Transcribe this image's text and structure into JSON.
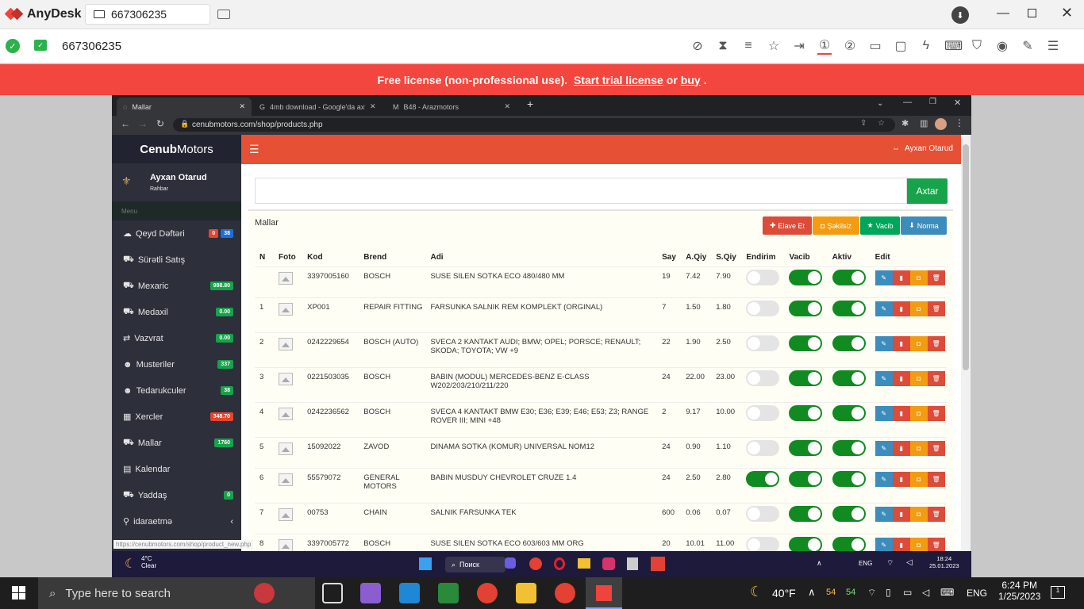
{
  "anydesk": {
    "app_name": "AnyDesk",
    "tab_id": "667306235",
    "address": "667306235",
    "license_text": "Free license (non-professional use).",
    "trial_link": "Start trial license",
    "or": "or",
    "buy_link": "buy",
    "end": "."
  },
  "browser": {
    "tabs": [
      {
        "title": "Mallar"
      },
      {
        "title": "4mb download - Google'da axtar"
      },
      {
        "title": "B48 - Arazmotors"
      }
    ],
    "url": "cenubmotors.com/shop/products.php",
    "status_url": "https://cenubmotors.com/shop/product_new.php"
  },
  "app": {
    "brand_bold": "Cenub",
    "brand_rest": " Motors",
    "user_name": "Ayxan Otarud",
    "user_role": "Rahbar",
    "menu_header": "Menu",
    "top_user": "Ayxan Otarud",
    "sidebar": [
      {
        "label": "Qeyd Dəftəri",
        "badge": "0",
        "badge_color": "#e5442e",
        "badge2": "38",
        "badge2_color": "#1d6fd8"
      },
      {
        "label": "Sürətli Satış"
      },
      {
        "label": "Mexaric",
        "badge": "988.80",
        "badge_color": "#16a34a"
      },
      {
        "label": "Medaxil",
        "badge": "0.00",
        "badge_color": "#16a34a"
      },
      {
        "label": "Vazvrat",
        "badge": "0.00",
        "badge_color": "#16a34a"
      },
      {
        "label": "Musteriler",
        "badge": "337",
        "badge_color": "#16a34a"
      },
      {
        "label": "Tedarukculer",
        "badge": "38",
        "badge_color": "#16a34a"
      },
      {
        "label": "Xercler",
        "badge": "348.70",
        "badge_color": "#e5442e"
      },
      {
        "label": "Mallar",
        "badge": "1760",
        "badge_color": "#16a34a"
      },
      {
        "label": "Kalendar"
      },
      {
        "label": "Yaddaş",
        "badge": "0",
        "badge_color": "#16a34a"
      },
      {
        "label": "idaraetmə",
        "chevron": "‹"
      }
    ],
    "search_button": "Axtar",
    "panel_title": "Mallar",
    "buttons": [
      {
        "label": "Elave Et",
        "color": "#dd4b39"
      },
      {
        "label": "Şəkilsiz",
        "color": "#f39c12"
      },
      {
        "label": "Vacib",
        "color": "#00a65a"
      },
      {
        "label": "Norma",
        "color": "#3c8dbc"
      }
    ],
    "columns": [
      "N",
      "Foto",
      "Kod",
      "Brend",
      "Adi",
      "Say",
      "A.Qiy",
      "S.Qiy",
      "Endirim",
      "Vacib",
      "Aktiv",
      "Edit"
    ],
    "rows": [
      {
        "n": "",
        "kod": "3397005160",
        "brend": "BOSCH",
        "adi": "SUSE SILEN SOTKA ECO 480/480 MM",
        "say": "19",
        "aqiy": "7.42",
        "sqiy": "7.90",
        "endirim": false,
        "vacib": true,
        "aktiv": true
      },
      {
        "n": "1",
        "kod": "XP001",
        "brend": "REPAIR FITTING",
        "adi": "FARSUNKA SALNIK REM KOMPLEKT (ORGINAL)",
        "say": "7",
        "aqiy": "1.50",
        "sqiy": "1.80",
        "endirim": false,
        "vacib": true,
        "aktiv": true
      },
      {
        "n": "2",
        "kod": "0242229654",
        "brend": "BOSCH (AUTO)",
        "adi": "SVECA 2 KANTAKT AUDI; BMW; OPEL; PORSCE; RENAULT; SKODA; TOYOTA; VW +9",
        "say": "22",
        "aqiy": "1.90",
        "sqiy": "2.50",
        "endirim": false,
        "vacib": true,
        "aktiv": true
      },
      {
        "n": "3",
        "kod": "0221503035",
        "brend": "BOSCH",
        "adi": "BABIN (MODUL) MERCEDES-BENZ E-CLASS W202/203/210/211/220",
        "say": "24",
        "aqiy": "22.00",
        "sqiy": "23.00",
        "endirim": false,
        "vacib": true,
        "aktiv": true
      },
      {
        "n": "4",
        "kod": "0242236562",
        "brend": "BOSCH",
        "adi": "SVECA 4 KANTAKT BMW E30; E36; E39; E46; E53; Z3; RANGE ROVER III; MINI +48",
        "say": "2",
        "aqiy": "9.17",
        "sqiy": "10.00",
        "endirim": false,
        "vacib": true,
        "aktiv": true
      },
      {
        "n": "5",
        "kod": "15092022",
        "brend": "ZAVOD",
        "adi": "DINAMA SOTKA (KOMUR) UNIVERSAL NOM12",
        "say": "24",
        "aqiy": "0.90",
        "sqiy": "1.10",
        "endirim": false,
        "vacib": true,
        "aktiv": true
      },
      {
        "n": "6",
        "kod": "55579072",
        "brend": "GENERAL MOTORS",
        "adi": "BABIN MUSDUY CHEVROLET CRUZE 1.4",
        "say": "24",
        "aqiy": "2.50",
        "sqiy": "2.80",
        "endirim": true,
        "vacib": true,
        "aktiv": true
      },
      {
        "n": "7",
        "kod": "00753",
        "brend": "CHAIN",
        "adi": "SALNIK FARSUNKA TEK",
        "say": "600",
        "aqiy": "0.06",
        "sqiy": "0.07",
        "endirim": false,
        "vacib": true,
        "aktiv": true
      },
      {
        "n": "8",
        "kod": "3397005772",
        "brend": "BOSCH",
        "adi": "SUSE SILEN SOTKA ECO 603/603 MM ORG",
        "say": "20",
        "aqiy": "10.01",
        "sqiy": "11.00",
        "endirim": false,
        "vacib": true,
        "aktiv": true
      }
    ]
  },
  "remote_taskbar": {
    "temp": "4°C",
    "weather": "Clear",
    "search": "Поиск",
    "lang": "ENG",
    "time": "18:24",
    "date": "25.01.2023"
  },
  "local_taskbar": {
    "search_placeholder": "Type here to search",
    "temp": "40°F",
    "lang": "ENG",
    "time": "6:24 PM",
    "date": "1/25/2023",
    "notif": "1",
    "tray_num": "54"
  }
}
